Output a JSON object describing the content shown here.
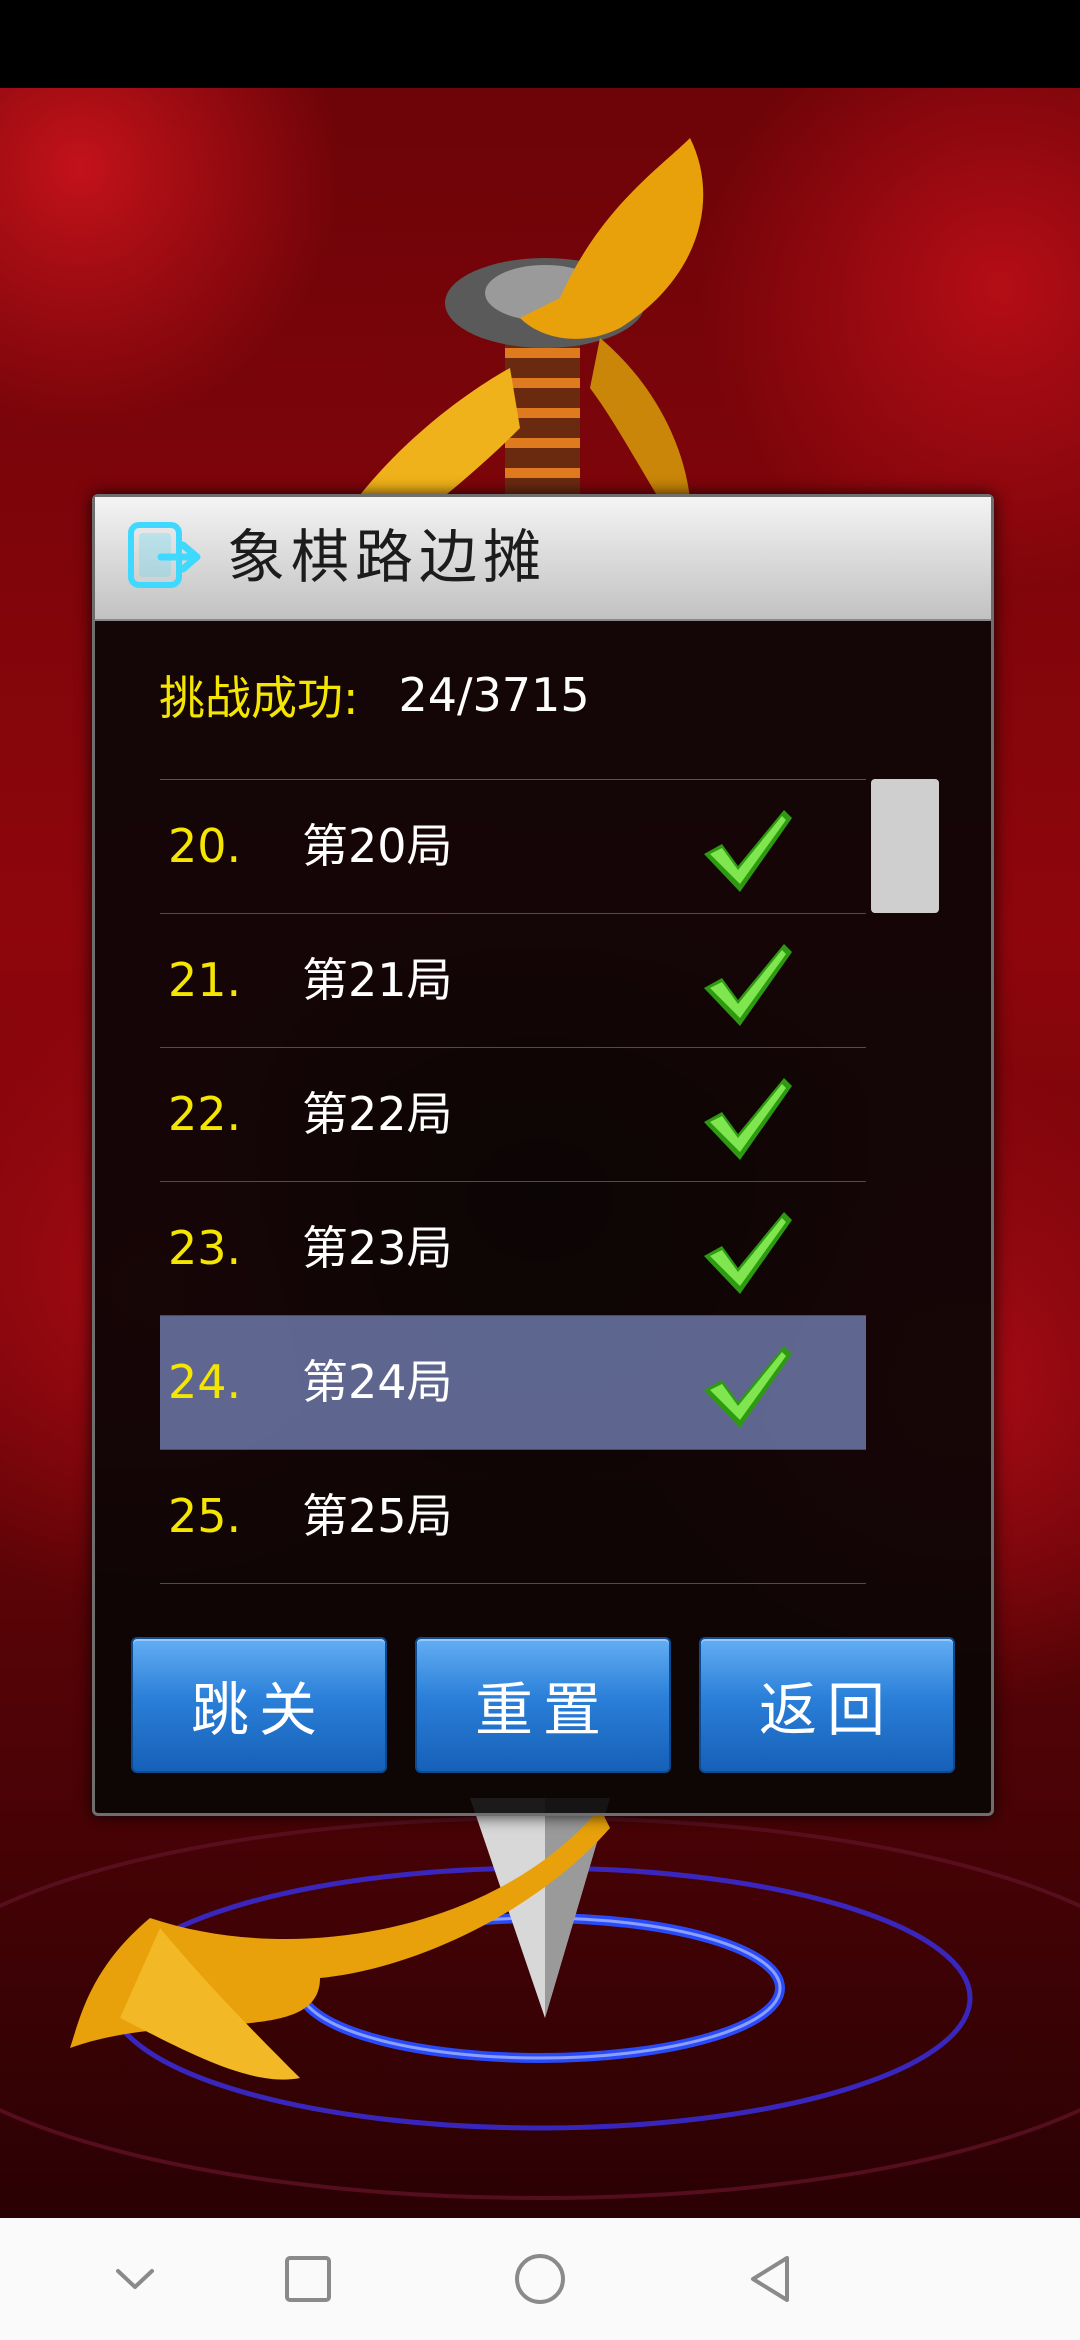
{
  "dialog": {
    "title": "象棋路边摊",
    "progress_label": "挑战成功:",
    "progress_value": "24/3715"
  },
  "levels": [
    {
      "num": "20.",
      "name": "第20局",
      "completed": true,
      "selected": false
    },
    {
      "num": "21.",
      "name": "第21局",
      "completed": true,
      "selected": false
    },
    {
      "num": "22.",
      "name": "第22局",
      "completed": true,
      "selected": false
    },
    {
      "num": "23.",
      "name": "第23局",
      "completed": true,
      "selected": false
    },
    {
      "num": "24.",
      "name": "第24局",
      "completed": true,
      "selected": true
    },
    {
      "num": "25.",
      "name": "第25局",
      "completed": false,
      "selected": false
    }
  ],
  "buttons": {
    "skip": "跳关",
    "reset": "重置",
    "back": "返回"
  },
  "icons": {
    "app": "app-exit-icon",
    "check": "checkmark-icon",
    "nav": [
      "chevron-down-icon",
      "recents-square-icon",
      "home-circle-icon",
      "back-triangle-icon"
    ]
  },
  "colors": {
    "accent_yellow": "#f4e600",
    "button_blue": "#2a7fd8",
    "selection": "#7887be",
    "check_green": "#3fbf1a"
  }
}
